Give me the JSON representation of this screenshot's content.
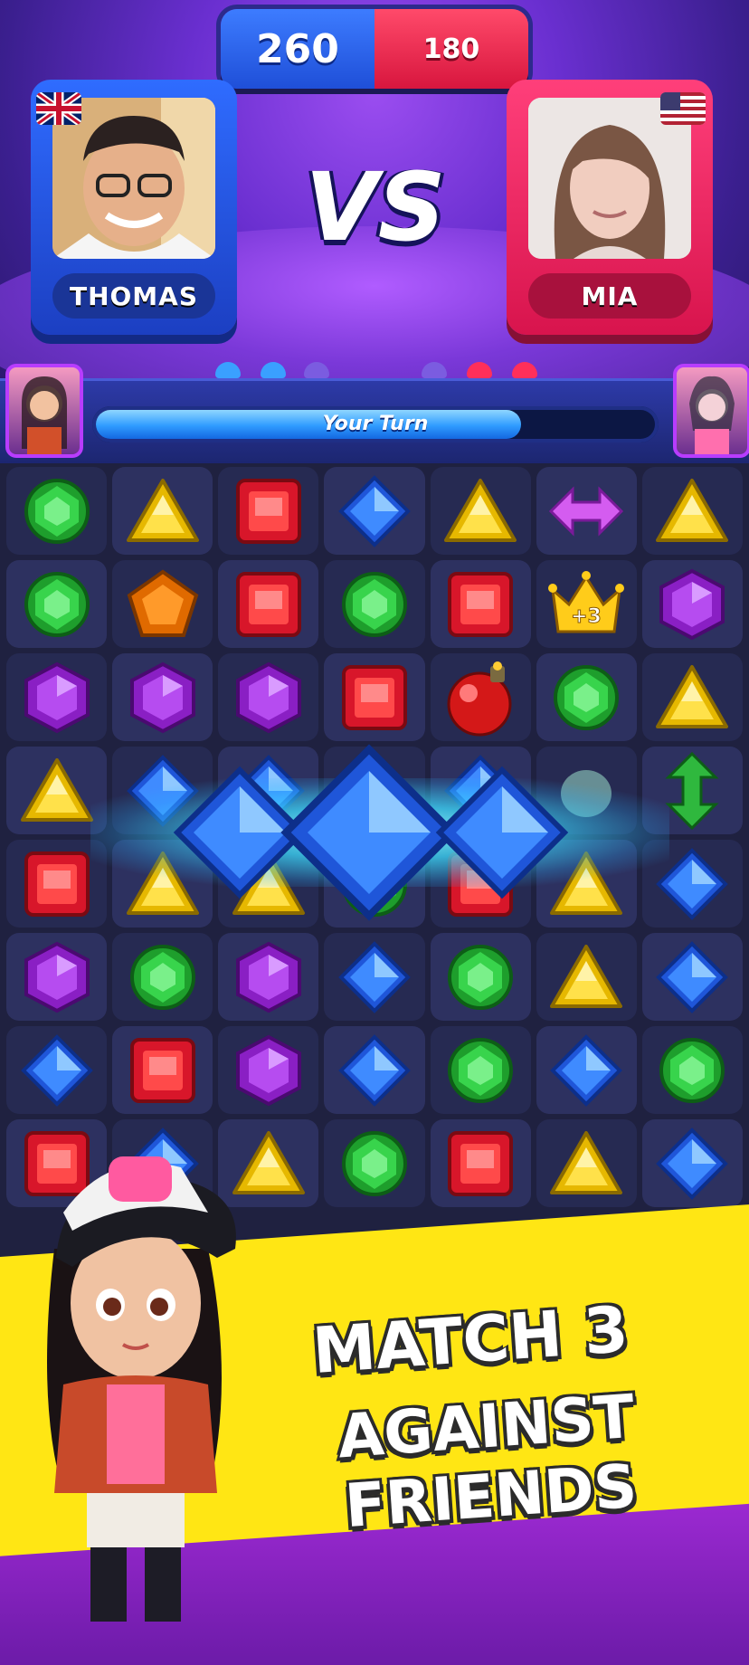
{
  "scores": {
    "left": "260",
    "right": "180"
  },
  "players": [
    {
      "name": "THOMAS",
      "flag": "uk-flag-icon"
    },
    {
      "name": "MIA",
      "flag": "us-flag-icon"
    }
  ],
  "vs_label": "VS",
  "turn": {
    "label": "Your Turn",
    "progress_fraction": 0.76
  },
  "booster": {
    "crown_label": "+3"
  },
  "slogan": {
    "line1": "MATCH 3",
    "line2": "AGAINST FRIENDS"
  },
  "colors": {
    "player_left": "#2f6cff",
    "player_right": "#ff3f7a",
    "banner": "#ffe614",
    "board_bg": "#1f2140"
  },
  "board": {
    "rows": [
      [
        "green",
        "yellow",
        "red",
        "blue",
        "yellow",
        "arrow-h",
        "yellow"
      ],
      [
        "green",
        "orange",
        "red",
        "green",
        "red",
        "crown",
        "purple"
      ],
      [
        "purple",
        "purple",
        "purple",
        "red",
        "bomb",
        "green",
        "yellow"
      ],
      [
        "yellow",
        "blue",
        "blue",
        "blue",
        "blue",
        "ghost",
        "arrow-v"
      ],
      [
        "red",
        "yellow",
        "yellow",
        "green",
        "red",
        "yellow",
        "blue"
      ],
      [
        "purple",
        "green",
        "purple",
        "blue",
        "green",
        "yellow",
        "blue"
      ],
      [
        "blue",
        "red",
        "purple",
        "blue",
        "green",
        "blue",
        "green"
      ],
      [
        "red",
        "blue",
        "yellow",
        "green",
        "red",
        "yellow",
        "blue"
      ]
    ]
  }
}
